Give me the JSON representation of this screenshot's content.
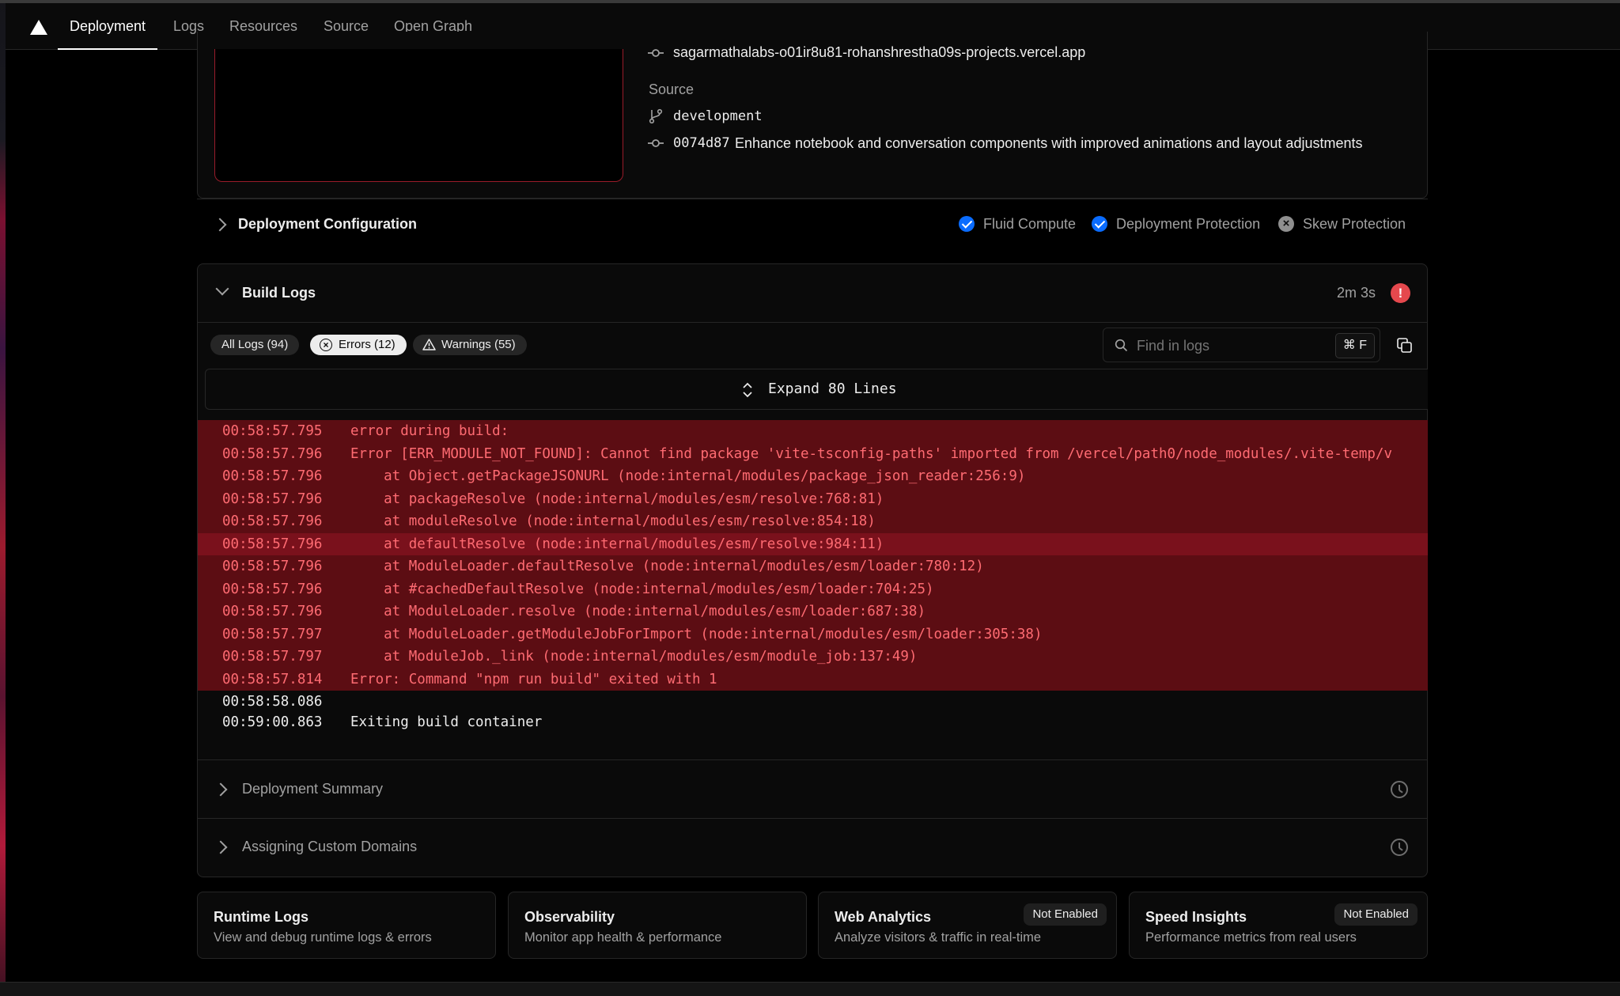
{
  "nav": {
    "tabs": [
      "Deployment",
      "Logs",
      "Resources",
      "Source",
      "Open Graph"
    ],
    "active_tab": "Deployment"
  },
  "deployment": {
    "domain": "sagarmathalabs-o01ir8u81-rohanshrestha09s-projects.vercel.app",
    "source_heading": "Source",
    "branch": "development",
    "commit_hash": "0074d87",
    "commit_message": "Enhance notebook and conversation components with improved animations and layout adjustments"
  },
  "config": {
    "title": "Deployment Configuration",
    "features": [
      {
        "label": "Fluid Compute",
        "enabled": true
      },
      {
        "label": "Deployment Protection",
        "enabled": true
      },
      {
        "label": "Skew Protection",
        "enabled": false
      }
    ]
  },
  "build_logs": {
    "title": "Build Logs",
    "duration": "2m 3s",
    "status_icon": "error-icon",
    "filters": {
      "all": "All Logs (94)",
      "errors": "Errors (12)",
      "warnings": "Warnings (55)"
    },
    "search_placeholder": "Find in logs",
    "shortcut": "⌘ F",
    "expand_label": "Expand 80 Lines",
    "lines": [
      {
        "time": "00:58:57.795",
        "text": "error during build:",
        "level": "error"
      },
      {
        "time": "00:58:57.796",
        "text": "Error [ERR_MODULE_NOT_FOUND]: Cannot find package 'vite-tsconfig-paths' imported from /vercel/path0/node_modules/.vite-temp/v",
        "level": "error"
      },
      {
        "time": "00:58:57.796",
        "text": "    at Object.getPackageJSONURL (node:internal/modules/package_json_reader:256:9)",
        "level": "error"
      },
      {
        "time": "00:58:57.796",
        "text": "    at packageResolve (node:internal/modules/esm/resolve:768:81)",
        "level": "error"
      },
      {
        "time": "00:58:57.796",
        "text": "    at moduleResolve (node:internal/modules/esm/resolve:854:18)",
        "level": "error"
      },
      {
        "time": "00:58:57.796",
        "text": "    at defaultResolve (node:internal/modules/esm/resolve:984:11)",
        "level": "error",
        "highlighted": true
      },
      {
        "time": "00:58:57.796",
        "text": "    at ModuleLoader.defaultResolve (node:internal/modules/esm/loader:780:12)",
        "level": "error"
      },
      {
        "time": "00:58:57.796",
        "text": "    at #cachedDefaultResolve (node:internal/modules/esm/loader:704:25)",
        "level": "error"
      },
      {
        "time": "00:58:57.796",
        "text": "    at ModuleLoader.resolve (node:internal/modules/esm/loader:687:38)",
        "level": "error"
      },
      {
        "time": "00:58:57.797",
        "text": "    at ModuleLoader.getModuleJobForImport (node:internal/modules/esm/loader:305:38)",
        "level": "error"
      },
      {
        "time": "00:58:57.797",
        "text": "    at ModuleJob._link (node:internal/modules/esm/module_job:137:49)",
        "level": "error"
      },
      {
        "time": "00:58:57.814",
        "text": "Error: Command \"npm run build\" exited with 1",
        "level": "error"
      },
      {
        "time": "00:58:58.086",
        "text": "",
        "level": "info"
      },
      {
        "time": "00:59:00.863",
        "text": "Exiting build container",
        "level": "info"
      }
    ]
  },
  "summary_sections": [
    {
      "title": "Deployment Summary"
    },
    {
      "title": "Assigning Custom Domains"
    }
  ],
  "bottom_cards": [
    {
      "title": "Runtime Logs",
      "desc": "View and debug runtime logs & errors",
      "badge": ""
    },
    {
      "title": "Observability",
      "desc": "Monitor app health & performance",
      "badge": ""
    },
    {
      "title": "Web Analytics",
      "desc": "Analyze visitors & traffic in real-time",
      "badge": "Not Enabled"
    },
    {
      "title": "Speed Insights",
      "desc": "Performance metrics from real users",
      "badge": "Not Enabled"
    }
  ],
  "colors": {
    "error_bg": "#5c0d13",
    "error_text": "#ff6b72",
    "accent_blue": "#0a6cff",
    "error_badge": "#e5484d"
  }
}
